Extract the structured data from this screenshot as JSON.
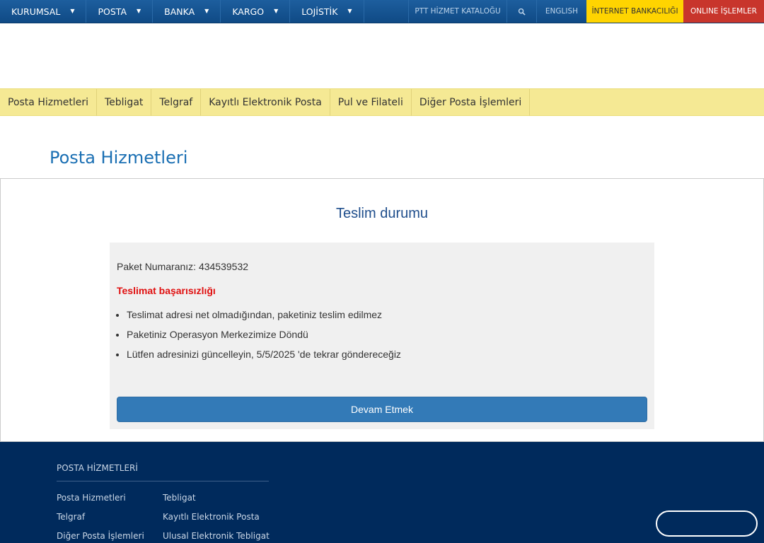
{
  "topnav": {
    "items": [
      {
        "label": "KURUMSAL"
      },
      {
        "label": "POSTA"
      },
      {
        "label": "BANKA"
      },
      {
        "label": "KARGO"
      },
      {
        "label": "LOJİSTİK"
      }
    ],
    "catalog": "PTT HİZMET KATALOĞU",
    "search_icon": "search-icon",
    "english": "ENGLISH",
    "bank": "İNTERNET BANKACILIĞI",
    "online": "ONLINE İŞLEMLER",
    "colors": {
      "bar": "#155596",
      "bank": "#ffd400",
      "online": "#c8352c"
    }
  },
  "subnav": {
    "items": [
      {
        "label": "Posta Hizmetleri"
      },
      {
        "label": "Tebligat"
      },
      {
        "label": "Telgraf"
      },
      {
        "label": "Kayıtlı Elektronik Posta"
      },
      {
        "label": "Pul ve Filateli"
      },
      {
        "label": "Diğer Posta İşlemleri"
      }
    ],
    "color": "#f5e994"
  },
  "page": {
    "title": "Posta Hizmetleri"
  },
  "status": {
    "title": "Teslim durumu",
    "package": "Paket Numaranız: 434539532",
    "failure": "Teslimat başarısızlığı",
    "bullets": [
      "Teslimat adresi net olmadığından, paketiniz teslim edilmez",
      "Paketiniz Operasyon Merkezimize Döndü",
      "Lütfen adresinizi güncelleyin, 5/5/2025 'de tekrar göndereceğiz"
    ],
    "button": "Devam Etmek",
    "colors": {
      "title": "#1f4e8c",
      "failure": "#e01010",
      "button": "#337ab7"
    }
  },
  "footer": {
    "heading": "POSTA HİZMETLERİ",
    "links": [
      "Posta Hizmetleri",
      "Tebligat",
      "Telgraf",
      "Kayıtlı Elektronik Posta",
      "Diğer Posta İşlemleri",
      "Ulusal Elektronik Tebligat"
    ],
    "color": "#002a5c"
  }
}
